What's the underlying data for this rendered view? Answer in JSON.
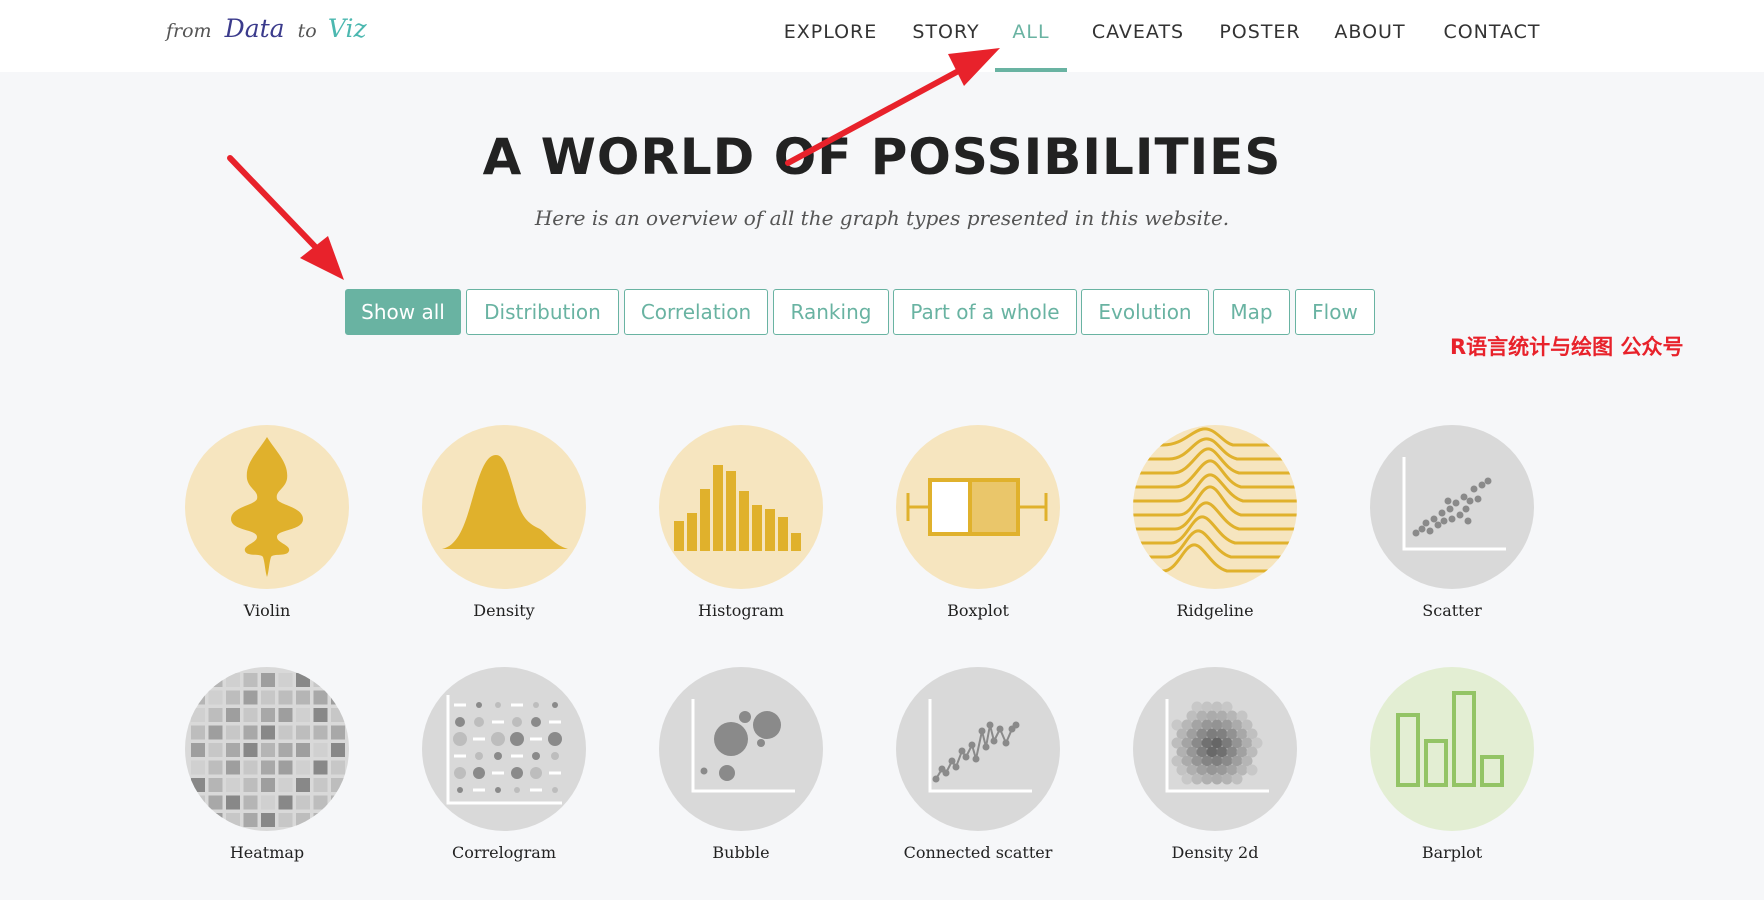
{
  "logo": {
    "from": "from",
    "data": "Data",
    "to": "to",
    "viz": "Viz"
  },
  "nav": {
    "items": [
      "EXPLORE",
      "STORY",
      "ALL",
      "CAVEATS",
      "POSTER",
      "ABOUT",
      "CONTACT"
    ],
    "active": "ALL"
  },
  "header": {
    "title": "A WORLD OF POSSIBILITIES",
    "subtitle": "Here is an overview of all the graph types presented in this website."
  },
  "filters": {
    "items": [
      "Show all",
      "Distribution",
      "Correlation",
      "Ranking",
      "Part of a whole",
      "Evolution",
      "Map",
      "Flow"
    ],
    "active": "Show all"
  },
  "watermark": "R语言统计与绘图 公众号",
  "charts": [
    {
      "label": "Violin",
      "icon": "violin-icon"
    },
    {
      "label": "Density",
      "icon": "density-icon"
    },
    {
      "label": "Histogram",
      "icon": "histogram-icon"
    },
    {
      "label": "Boxplot",
      "icon": "boxplot-icon"
    },
    {
      "label": "Ridgeline",
      "icon": "ridgeline-icon"
    },
    {
      "label": "Scatter",
      "icon": "scatter-icon"
    },
    {
      "label": "Heatmap",
      "icon": "heatmap-icon"
    },
    {
      "label": "Correlogram",
      "icon": "correlogram-icon"
    },
    {
      "label": "Bubble",
      "icon": "bubble-icon"
    },
    {
      "label": "Connected scatter",
      "icon": "connected-scatter-icon"
    },
    {
      "label": "Density 2d",
      "icon": "density-2d-icon"
    },
    {
      "label": "Barplot",
      "icon": "barplot-icon"
    }
  ],
  "colors": {
    "accent": "#69b3a2",
    "distribution_fill": "#f6e5bf",
    "distribution_mark": "#e0b12c",
    "correlation_fill": "#d9d9d9",
    "correlation_mark": "#8a8a8a",
    "ranking_fill": "#e3eed3",
    "ranking_mark": "#93c465",
    "annotation_red": "#e8222b"
  }
}
